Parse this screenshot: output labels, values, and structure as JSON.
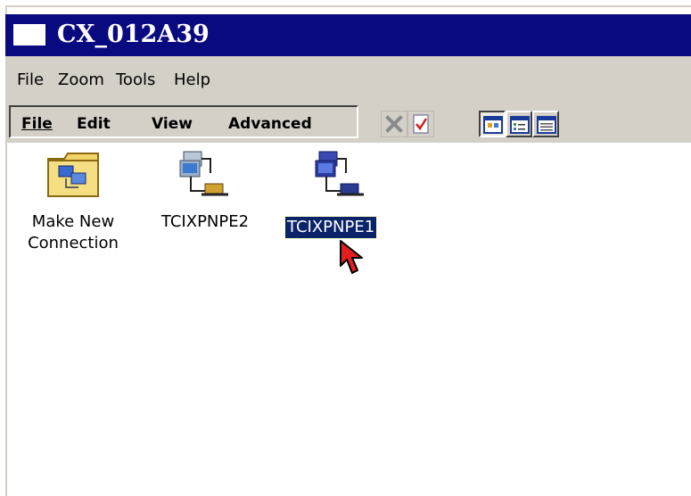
{
  "window": {
    "title": "CX_012A39"
  },
  "menubar": {
    "items": [
      "File",
      "Zoom",
      "Tools",
      "Help"
    ]
  },
  "commandbar": {
    "items": [
      "File",
      "Edit",
      "View",
      "Advanced"
    ],
    "toolbar": [
      {
        "name": "delete",
        "icon": "delete-x-icon",
        "state": "disabled"
      },
      {
        "name": "properties",
        "icon": "properties-check-icon",
        "state": "normal"
      },
      {
        "name": "large-icons",
        "icon": "large-icons-view-icon",
        "state": "pressed"
      },
      {
        "name": "small-icons",
        "icon": "small-icons-view-icon",
        "state": "normal"
      },
      {
        "name": "details",
        "icon": "details-view-icon",
        "state": "normal"
      }
    ]
  },
  "connections": [
    {
      "label_line1": "Make New",
      "label_line2": "Connection",
      "icon": "make-new-connection-icon",
      "selected": false
    },
    {
      "label_line1": "TCIXPNPE2",
      "icon": "network-connection-icon",
      "selected": false
    },
    {
      "label_line1": "TCIXPNPE1",
      "icon": "network-connection-active-icon",
      "selected": true
    }
  ],
  "colors": {
    "titlebar": "#0a0a80",
    "chrome": "#d4d0c8",
    "selection": "#0a246a",
    "cursor": "#e02020"
  }
}
